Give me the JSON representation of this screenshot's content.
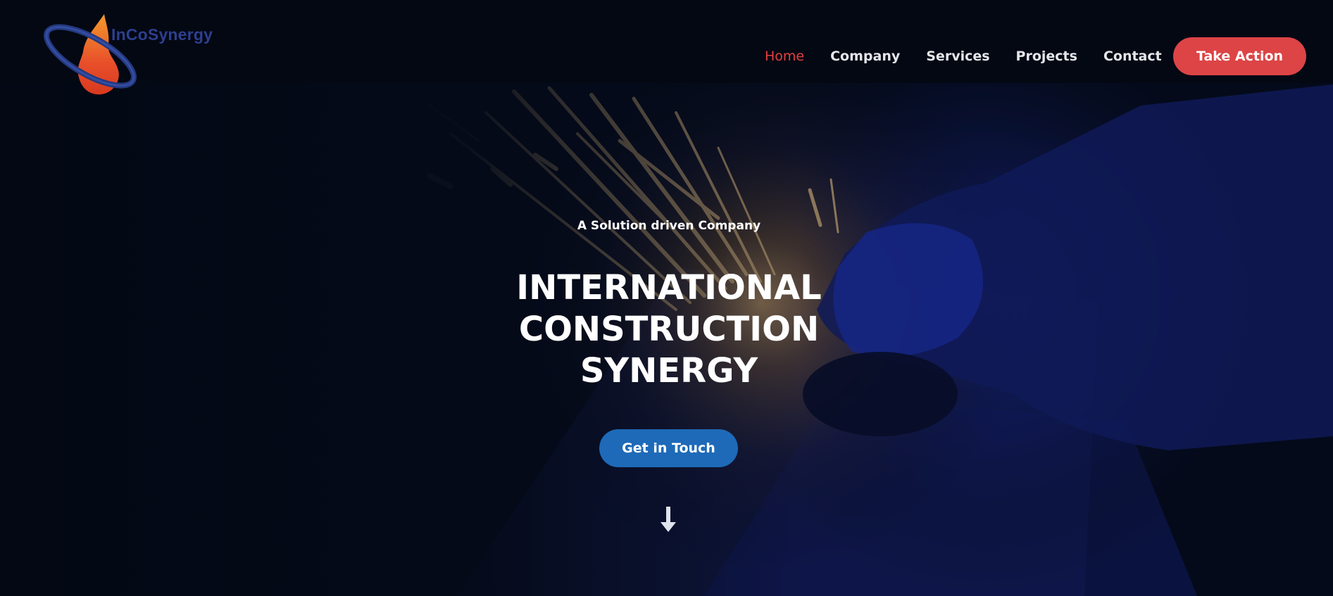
{
  "brand": {
    "name": "InCoSynergy"
  },
  "nav": {
    "items": [
      {
        "label": "Home",
        "active": true
      },
      {
        "label": "Company",
        "active": false
      },
      {
        "label": "Services",
        "active": false
      },
      {
        "label": "Projects",
        "active": false
      },
      {
        "label": "Contact",
        "active": false
      }
    ],
    "cta_label": "Take Action"
  },
  "hero": {
    "tagline": "A Solution driven Company",
    "title_lines": [
      "INTERNATIONAL",
      "CONSTRUCTION",
      "SYNERGY"
    ],
    "button_label": "Get in Touch",
    "scroll_icon": "arrow-down-icon"
  },
  "colors": {
    "accent_red": "#dd4446",
    "active_nav": "#e2413e",
    "primary_blue": "#1e6ab8",
    "header_bg": "#030813",
    "logo_text": "#2e3f8f"
  }
}
